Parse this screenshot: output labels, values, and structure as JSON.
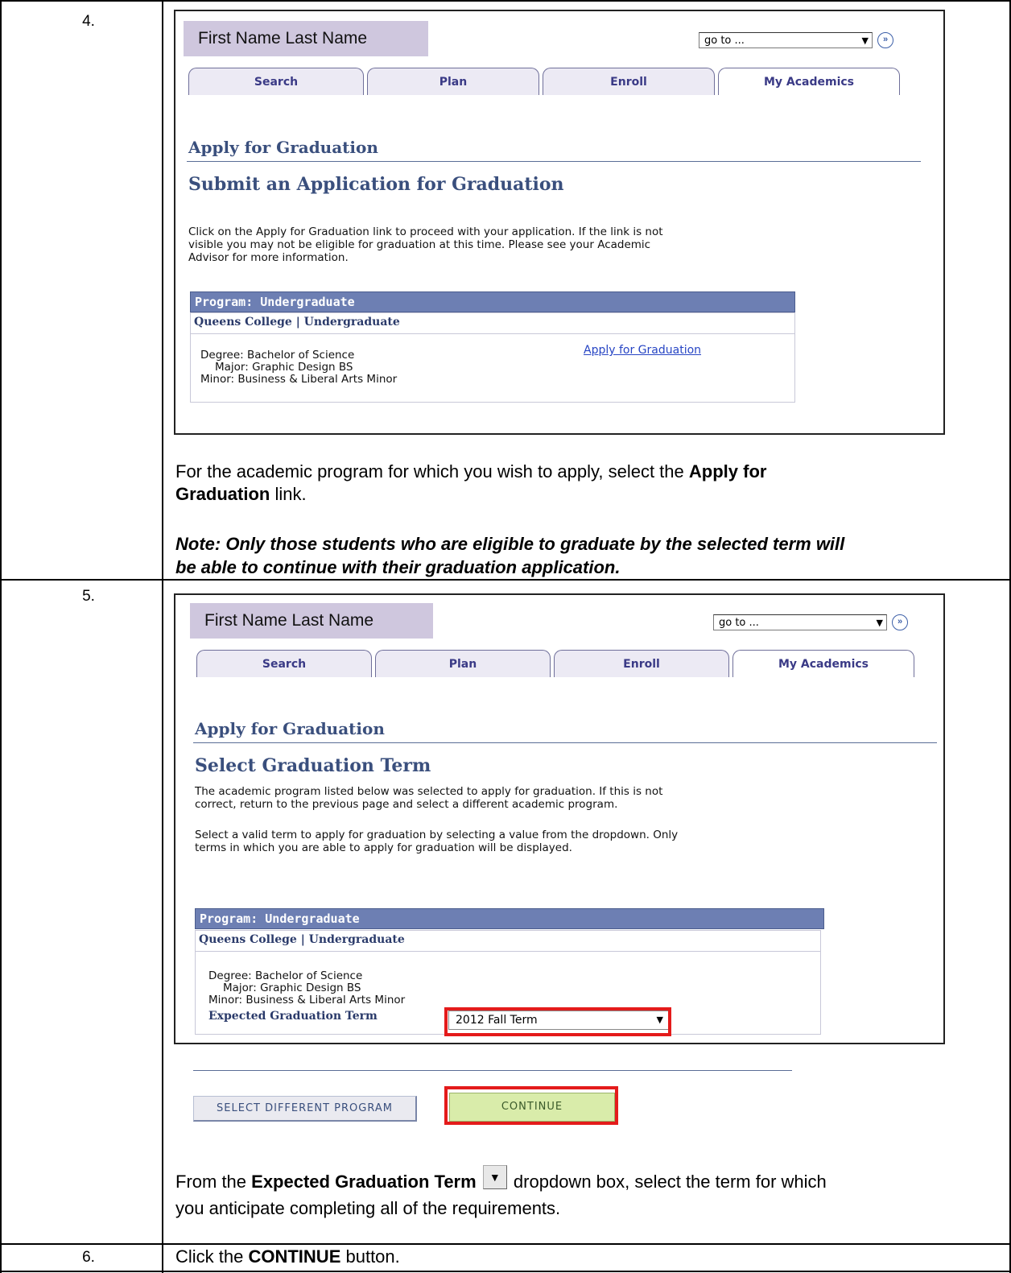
{
  "steps": [
    {
      "number": "4.",
      "screen": {
        "user_name": "First Name Last Name",
        "goto_value": "go to ...",
        "tabs": [
          "Search",
          "Plan",
          "Enroll",
          "My Academics"
        ],
        "heading": "Apply for Graduation",
        "subheading": "Submit an Application for Graduation",
        "paragraph_lines": [
          "Click on the Apply for Graduation link to proceed with your application. If the link is not",
          "visible you may not be eligible for graduation at this time. Please see your Academic",
          "Advisor for more information."
        ],
        "program_header": "Program: Undergraduate",
        "college": "Queens College | Undergraduate",
        "degree": "Degree: Bachelor of Science",
        "major": "Major: Graphic Design BS",
        "minor": "Minor: Business & Liberal Arts Minor",
        "apply_link": "Apply for Graduation"
      },
      "instruction": {
        "part1": "For the academic program for which you wish to apply, select the ",
        "bold1": "Apply for",
        "bold2": "Graduation",
        "part2": " link."
      },
      "note_lines": [
        "Note:  Only those students who are eligible to graduate by the selected term will",
        "be able to continue with their graduation application."
      ]
    },
    {
      "number": "5.",
      "screen": {
        "user_name": "First Name Last Name",
        "goto_value": "go to ...",
        "tabs": [
          "Search",
          "Plan",
          "Enroll",
          "My Academics"
        ],
        "heading": "Apply for Graduation",
        "subheading": "Select Graduation Term",
        "paragraph1_lines": [
          "The academic program listed below was selected to apply for graduation. If this is not",
          "correct, return to the previous page and select a different academic program."
        ],
        "paragraph2_lines": [
          "Select a valid term to apply for graduation by selecting a value from the dropdown. Only",
          "terms in which you are able to apply for graduation will be displayed."
        ],
        "program_header": "Program: Undergraduate",
        "college": "Queens College | Undergraduate",
        "degree": "Degree: Bachelor of Science",
        "major": "Major: Graphic Design BS",
        "minor": "Minor: Business & Liberal Arts Minor",
        "expected_label": "Expected Graduation Term",
        "term_value": "2012 Fall Term",
        "select_program_button": "SELECT DIFFERENT PROGRAM",
        "continue_button": "CONTINUE",
        "highlight_color": "#e41b1b"
      },
      "instruction": {
        "part1": "From the ",
        "bold1": "Expected Graduation Term",
        "part2": " dropdown box, select the term for which",
        "line2": "you anticipate completing all of the requirements.",
        "icon": "dropdown-arrow-icon"
      }
    },
    {
      "number": "6.",
      "instruction": {
        "part1": "Click the ",
        "bold1": "CONTINUE",
        "part2": " button."
      }
    }
  ]
}
